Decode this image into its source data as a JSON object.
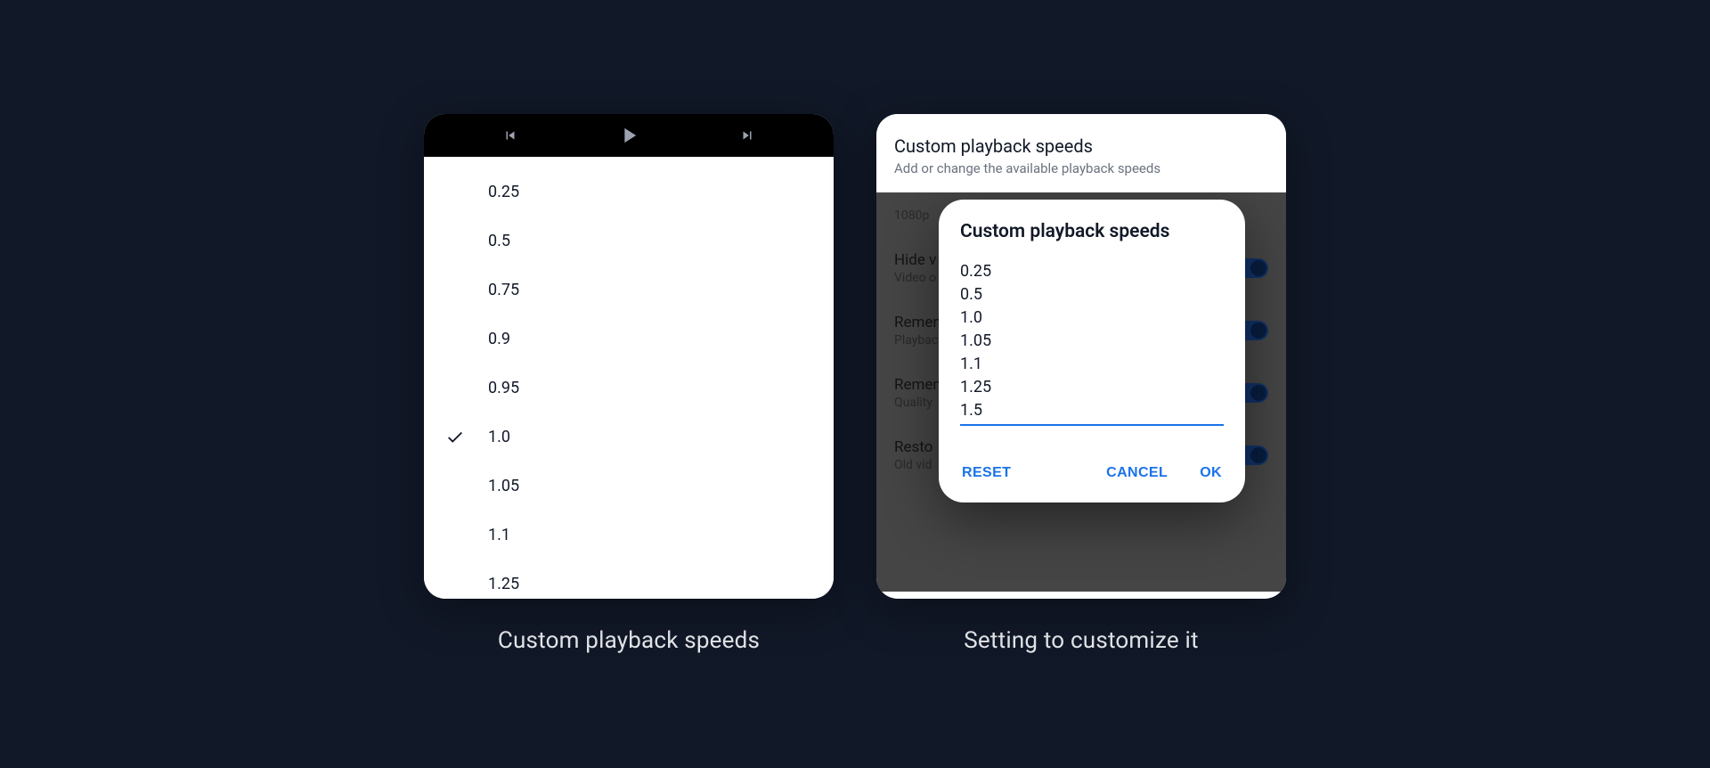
{
  "left": {
    "caption": "Custom playback speeds",
    "selected_speed": "1.0",
    "speeds": [
      "0.25",
      "0.5",
      "0.75",
      "0.9",
      "0.95",
      "1.0",
      "1.05",
      "1.1",
      "1.25"
    ]
  },
  "right": {
    "caption": "Setting to customize it",
    "header": {
      "title": "Custom playback speeds",
      "subtitle": "Add or change the available playback speeds"
    },
    "background_settings": [
      {
        "primary": "",
        "secondary": "1080p",
        "toggle": false
      },
      {
        "primary": "Hide v",
        "secondary": "Video o",
        "toggle": true
      },
      {
        "primary": "Remen",
        "secondary": "Playbac",
        "toggle": true
      },
      {
        "primary": "Remen",
        "secondary": "Quality",
        "toggle": true
      },
      {
        "primary": "Resto",
        "secondary": "Old vid",
        "toggle": true
      }
    ],
    "dialog": {
      "title": "Custom playback speeds",
      "value": "0.25\n0.5\n1.0\n1.05\n1.1\n1.25\n1.5",
      "buttons": {
        "reset": "RESET",
        "cancel": "CANCEL",
        "ok": "OK"
      }
    }
  }
}
